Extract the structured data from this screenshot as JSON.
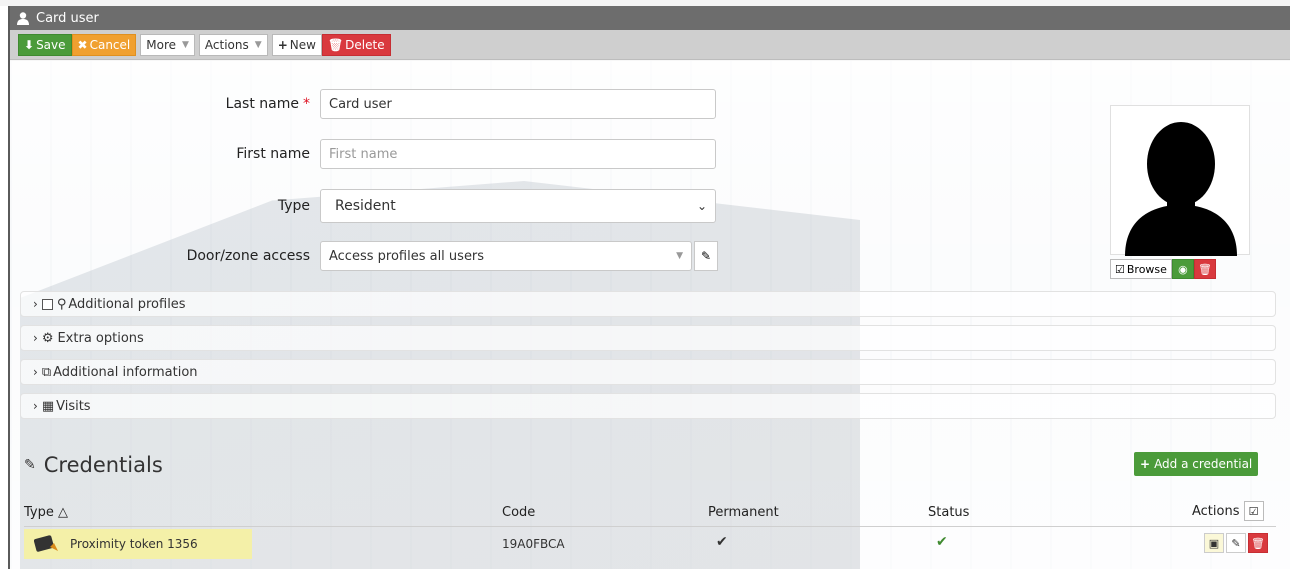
{
  "window": {
    "title": "Card user"
  },
  "toolbar": {
    "save": "Save",
    "cancel": "Cancel",
    "more": "More",
    "actions": "Actions",
    "new": "New",
    "delete": "Delete"
  },
  "form": {
    "last_name_label": "Last name",
    "last_name_value": "Card user",
    "first_name_label": "First name",
    "first_name_placeholder": "First name",
    "type_label": "Type",
    "type_value": "Resident",
    "door_label": "Door/zone access",
    "door_value": "Access profiles all users"
  },
  "photo": {
    "browse_label": "Browse"
  },
  "sections": {
    "additional_profiles": "Additional profiles",
    "extra_options": "Extra options",
    "additional_information": "Additional information",
    "visits": "Visits"
  },
  "credentials": {
    "title": "Credentials",
    "add_label": "Add a credential",
    "columns": {
      "type": "Type △",
      "code": "Code",
      "permanent": "Permanent",
      "status": "Status",
      "actions": "Actions"
    },
    "rows": [
      {
        "type": "Proximity token 1356",
        "code": "19A0FBCA",
        "permanent": "✔",
        "status": "✔"
      }
    ]
  },
  "colors": {
    "save": "#4b9b3a",
    "cancel": "#f0a030",
    "delete": "#d9393e",
    "titlebar": "#6d6d6d"
  }
}
